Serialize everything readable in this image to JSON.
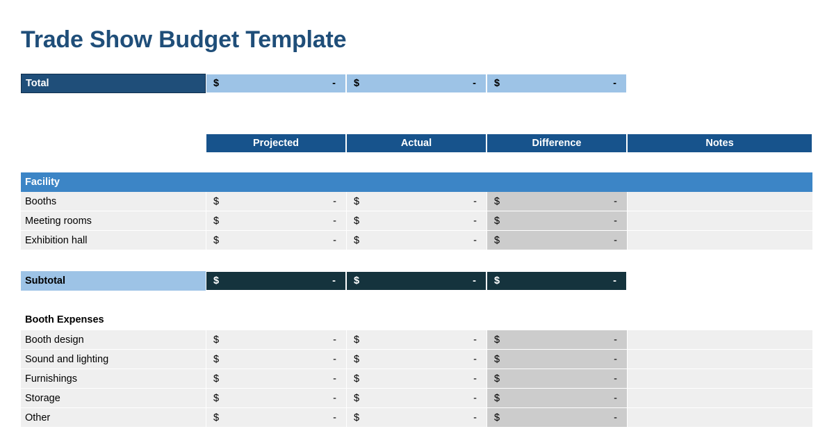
{
  "document": {
    "title": "Trade Show Budget Template"
  },
  "colors": {
    "title_blue": "#1F4E79",
    "header_blue": "#17538C",
    "band_blue": "#3C85C6",
    "light_blue": "#9DC3E6",
    "dark_navy": "#1F4E79",
    "subtotal_dark": "#15333D",
    "row_gray": "#EFEFEF",
    "difference_gray": "#CCCCCC"
  },
  "total_row": {
    "label": "Total",
    "projected": {
      "currency": "$",
      "value": "-"
    },
    "actual": {
      "currency": "$",
      "value": "-"
    },
    "difference": {
      "currency": "$",
      "value": "-"
    }
  },
  "column_headers": {
    "projected": "Projected",
    "actual": "Actual",
    "difference": "Difference",
    "notes": "Notes"
  },
  "sections": [
    {
      "name": "Facility",
      "style": "band",
      "rows": [
        {
          "label": "Booths",
          "projected": {
            "currency": "$",
            "value": "-"
          },
          "actual": {
            "currency": "$",
            "value": "-"
          },
          "difference": {
            "currency": "$",
            "value": "-"
          },
          "notes": ""
        },
        {
          "label": "Meeting rooms",
          "projected": {
            "currency": "$",
            "value": "-"
          },
          "actual": {
            "currency": "$",
            "value": "-"
          },
          "difference": {
            "currency": "$",
            "value": "-"
          },
          "notes": ""
        },
        {
          "label": "Exhibition hall",
          "projected": {
            "currency": "$",
            "value": "-"
          },
          "actual": {
            "currency": "$",
            "value": "-"
          },
          "difference": {
            "currency": "$",
            "value": "-"
          },
          "notes": ""
        }
      ]
    },
    {
      "name": "Booth Expenses",
      "style": "plain",
      "rows": [
        {
          "label": "Booth design",
          "projected": {
            "currency": "$",
            "value": "-"
          },
          "actual": {
            "currency": "$",
            "value": "-"
          },
          "difference": {
            "currency": "$",
            "value": "-"
          },
          "notes": ""
        },
        {
          "label": "Sound and lighting",
          "projected": {
            "currency": "$",
            "value": "-"
          },
          "actual": {
            "currency": "$",
            "value": "-"
          },
          "difference": {
            "currency": "$",
            "value": "-"
          },
          "notes": ""
        },
        {
          "label": "Furnishings",
          "projected": {
            "currency": "$",
            "value": "-"
          },
          "actual": {
            "currency": "$",
            "value": "-"
          },
          "difference": {
            "currency": "$",
            "value": "-"
          },
          "notes": ""
        },
        {
          "label": "Storage",
          "projected": {
            "currency": "$",
            "value": "-"
          },
          "actual": {
            "currency": "$",
            "value": "-"
          },
          "difference": {
            "currency": "$",
            "value": "-"
          },
          "notes": ""
        },
        {
          "label": "Other",
          "projected": {
            "currency": "$",
            "value": "-"
          },
          "actual": {
            "currency": "$",
            "value": "-"
          },
          "difference": {
            "currency": "$",
            "value": "-"
          },
          "notes": ""
        }
      ]
    }
  ],
  "subtotal_row": {
    "label": "Subtotal",
    "projected": {
      "currency": "$",
      "value": "-"
    },
    "actual": {
      "currency": "$",
      "value": "-"
    },
    "difference": {
      "currency": "$",
      "value": "-"
    }
  }
}
